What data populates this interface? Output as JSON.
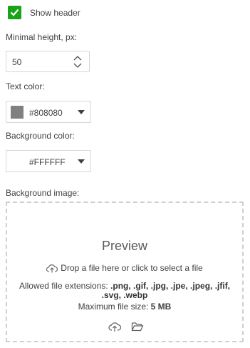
{
  "show_header": {
    "label": "Show header",
    "checked": true
  },
  "min_height": {
    "label": "Minimal height, px:",
    "value": "50"
  },
  "text_color": {
    "label": "Text color:",
    "value": "#808080",
    "swatch": "#808080"
  },
  "background_color": {
    "label": "Background color:",
    "value": "#FFFFFF",
    "swatch": "#ffffff"
  },
  "background_image": {
    "label": "Background image:",
    "preview_title": "Preview",
    "drop_text": "Drop a file here or click to select a file",
    "extensions_prefix": "Allowed file extensions:",
    "extensions": ".png, .gif, .jpg, .jpe, .jpeg, .jfif, .svg, .webp",
    "max_size_prefix": "Maximum file size:",
    "max_size": "5 MB"
  },
  "colors": {
    "accent": "#19a319",
    "border": "#d6d6d6",
    "dashed": "#cfcfcf"
  },
  "icons": [
    "check-icon",
    "chevron-up-icon",
    "chevron-down-icon",
    "dropdown-arrow-icon",
    "cloud-upload-icon",
    "folder-icon"
  ]
}
